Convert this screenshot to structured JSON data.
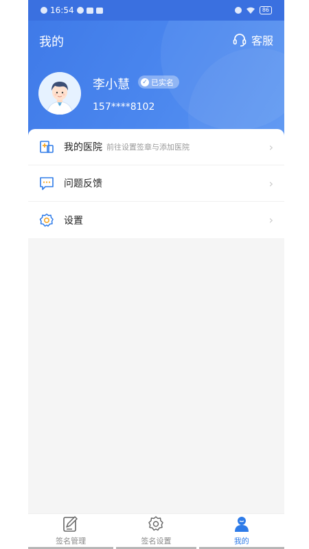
{
  "status_bar": {
    "time": "16:54",
    "battery": "86"
  },
  "header": {
    "title": "我的",
    "service_label": "客服"
  },
  "user": {
    "name": "李小慧",
    "verified_label": "已实名",
    "phone": "157****8102"
  },
  "menu": {
    "items": [
      {
        "label": "我的医院",
        "sub": "前往设置签章与添加医院",
        "icon": "hospital-icon"
      },
      {
        "label": "问题反馈",
        "sub": "",
        "icon": "feedback-icon"
      },
      {
        "label": "设置",
        "sub": "",
        "icon": "settings-icon"
      }
    ]
  },
  "tabbar": {
    "tabs": [
      {
        "label": "签名管理",
        "icon": "edit-icon",
        "active": false
      },
      {
        "label": "签名设置",
        "icon": "gear-icon",
        "active": false
      },
      {
        "label": "我的",
        "icon": "user-icon",
        "active": true
      }
    ]
  },
  "colors": {
    "accent": "#2e7be8",
    "header_blue": "#4a86ee",
    "background": "#f5f5f5"
  }
}
